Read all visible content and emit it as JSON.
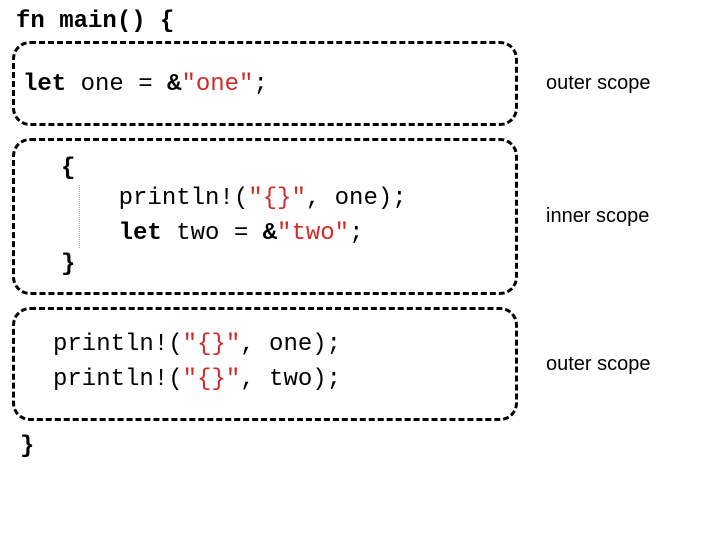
{
  "code": {
    "fn_open": "fn main() {",
    "fn_close": "}",
    "outer1": {
      "line1_pre": "let ",
      "line1_mid": "one = ",
      "line1_amp": "&",
      "line1_str": "\"one\"",
      "line1_end": ";"
    },
    "inner": {
      "brace_open": "{",
      "line1_a": "println!(",
      "line1_fmt": "\"{}\"",
      "line1_b": ", one);",
      "line2_let": "let ",
      "line2_mid": "two = ",
      "line2_amp": "&",
      "line2_str": "\"two\"",
      "line2_end": ";",
      "brace_close": "}"
    },
    "outer2": {
      "l1a": "println!(",
      "l1fmt": "\"{}\"",
      "l1b": ", one);",
      "l2a": "println!(",
      "l2fmt": "\"{}\"",
      "l2b": ", two);"
    }
  },
  "labels": {
    "outer": "outer scope",
    "inner": "inner scope"
  }
}
